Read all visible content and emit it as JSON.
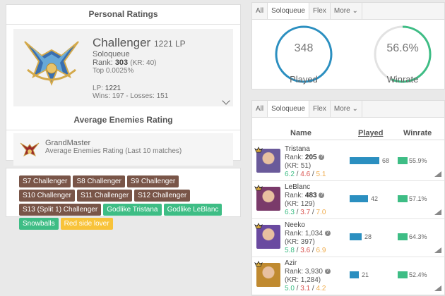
{
  "personal": {
    "title": "Personal Ratings",
    "tier": "Challenger",
    "lp_display": "1221 LP",
    "queue": "Soloqueue",
    "rank_label": "Rank:",
    "rank_value": "303",
    "rank_kr": "(KR: 40)",
    "top": "Top 0.0025%",
    "lp_label": "LP:",
    "lp_value": "1221",
    "wins_losses": "Wins: 197 - Losses: 151"
  },
  "average": {
    "title": "Average Enemies Rating",
    "tier": "GrandMaster",
    "subtitle": "Average Enemies Rating (Last 10 matches)"
  },
  "badges": [
    {
      "label": "S7 Challenger",
      "color": "brown"
    },
    {
      "label": "S8 Challenger",
      "color": "brown"
    },
    {
      "label": "S9 Challenger",
      "color": "brown"
    },
    {
      "label": "S10 Challenger",
      "color": "brown"
    },
    {
      "label": "S11 Challenger",
      "color": "brown"
    },
    {
      "label": "S12 Challenger",
      "color": "brown"
    },
    {
      "label": "S13 (Split 1) Challenger",
      "color": "brown"
    },
    {
      "label": "Godlike Tristana",
      "color": "green"
    },
    {
      "label": "Godlike LeBlanc",
      "color": "green"
    },
    {
      "label": "Snowballs",
      "color": "green"
    },
    {
      "label": "Red side lover",
      "color": "yellow"
    }
  ],
  "tabs": [
    "All",
    "Soloqueue",
    "Flex",
    "More"
  ],
  "stats": {
    "played_value": "348",
    "played_label": "Played",
    "winrate_value": "56.6%",
    "winrate_fraction": 0.566,
    "winrate_label": "Winrate"
  },
  "table": {
    "headers": {
      "name": "Name",
      "played": "Played",
      "winrate": "Winrate"
    },
    "rows": [
      {
        "name": "Tristana",
        "rank_label": "Rank:",
        "rank": "205",
        "kr": "(KR: 51)",
        "k": "6.2",
        "d": "4.6",
        "a": "5.1",
        "played": "68",
        "played_frac": 1.0,
        "winrate": "55.9%",
        "color": "#6a5a9a"
      },
      {
        "name": "LeBlanc",
        "rank_label": "Rank:",
        "rank": "483",
        "kr": "(KR: 129)",
        "k": "6.3",
        "d": "3.7",
        "a": "7.0",
        "played": "42",
        "played_frac": 0.62,
        "winrate": "57.1%",
        "color": "#7a3a6a"
      },
      {
        "name": "Neeko",
        "rank_label": "Rank: 1,034",
        "rank": "",
        "kr": "(KR: 397)",
        "k": "5.8",
        "d": "3.6",
        "a": "6.9",
        "played": "28",
        "played_frac": 0.41,
        "winrate": "64.3%",
        "color": "#6a4aa0"
      },
      {
        "name": "Azir",
        "rank_label": "Rank: 3,930",
        "rank": "",
        "kr": "(KR: 1,284)",
        "k": "5.0",
        "d": "3.1",
        "a": "4.2",
        "played": "21",
        "played_frac": 0.31,
        "winrate": "52.4%",
        "color": "#c08a30"
      }
    ]
  },
  "colors": {
    "accent": "#2b8fc0",
    "green": "#3ebd85",
    "brown": "#795548",
    "yellow": "#f8c33a",
    "red": "#d9534f"
  }
}
